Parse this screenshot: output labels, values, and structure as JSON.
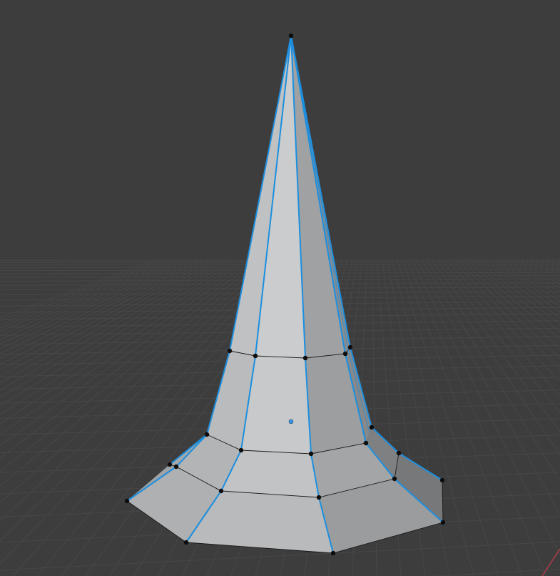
{
  "viewport": {
    "mode": "edit-mode",
    "object": "cone-mesh",
    "colors": {
      "background": "#3d3d3d",
      "grid_line": "#474747",
      "grid_line_strong": "#4d4d4d",
      "x_axis": "#b03a48",
      "face_light": "#c4c6c7",
      "face_mid": "#a9abac",
      "face_dark": "#8c8e8f",
      "face_darker": "#76787a",
      "selected_edge": "#1c8fe0",
      "unselected_edge": "#1a1a1a",
      "vertex": "#0d0d0d",
      "origin": "#3b9be8"
    }
  }
}
